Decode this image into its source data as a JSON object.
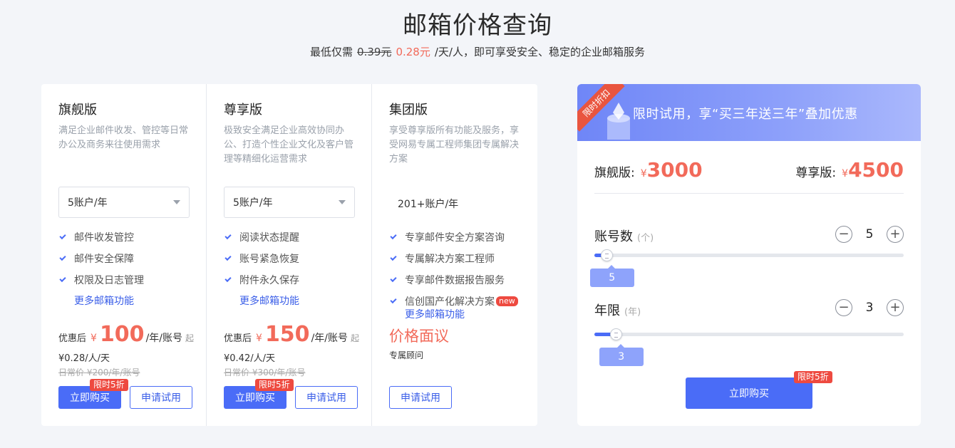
{
  "header": {
    "title": "邮箱价格查询",
    "subtitle_prefix": "最低仅需",
    "old_price": "0.39元",
    "new_price": "0.28元",
    "subtitle_suffix": "/天/人，即可享受安全、稳定的企业邮箱服务"
  },
  "plans": [
    {
      "name": "旗舰版",
      "desc": "满足企业邮件收发、管控等日常办公及商务来往使用需求",
      "account_select": "5账户/年",
      "features": [
        "邮件收发管控",
        "邮件安全保障",
        "权限及日志管理"
      ],
      "more": "更多邮箱功能",
      "price_prefix": "优惠后",
      "currency": "¥",
      "price": "100",
      "price_unit": "/年/账号",
      "price_suffix": "起",
      "daily": "¥0.28/人/天",
      "original": "日常价 ¥200/年/账号",
      "discount_tag": "限时5折",
      "buy": "立即购买",
      "trial": "申请试用"
    },
    {
      "name": "尊享版",
      "desc": "极致安全满足企业高效协同办公、打造个性企业文化及客户管理等精细化运营需求",
      "account_select": "5账户/年",
      "features": [
        "阅读状态提醒",
        "账号紧急恢复",
        "附件永久保存"
      ],
      "more": "更多邮箱功能",
      "price_prefix": "优惠后",
      "currency": "¥",
      "price": "150",
      "price_unit": "/年/账号",
      "price_suffix": "起",
      "daily": "¥0.42/人/天",
      "original": "日常价 ¥300/年/账号",
      "discount_tag": "限时5折",
      "buy": "立即购买",
      "trial": "申请试用"
    },
    {
      "name": "集团版",
      "desc": "享受尊享版所有功能及服务，享受网易专属工程师集团专属解决方案",
      "account_static": "201+账户/年",
      "features": [
        "专享邮件安全方案咨询",
        "专属解决方案工程师",
        "专享邮件数据报告服务",
        "信创国产化解决方案"
      ],
      "new_badge": "new",
      "more": "更多邮箱功能",
      "negotiate": "价格面议",
      "consult": "专属顾问",
      "trial": "申请试用"
    }
  ],
  "promo": {
    "ribbon": "限时折扣",
    "headline": "限时试用，享“买三年送三年”叠加优惠",
    "flagship_label": "旗舰版:",
    "flagship_currency": "¥",
    "flagship_price": "3000",
    "premium_label": "尊享版:",
    "premium_currency": "¥",
    "premium_price": "4500",
    "accounts_label": "账号数",
    "accounts_unit": "(个)",
    "accounts_value": "5",
    "accounts_fill_fraction": 0.02,
    "years_label": "年限",
    "years_unit": "(年)",
    "years_value": "3",
    "years_fill_fraction": 0.05,
    "minus": "−",
    "plus": "+",
    "discount_tag": "限时5折",
    "buy": "立即购买"
  },
  "colors": {
    "accent": "#4a6cf7",
    "price": "#f26a5a",
    "tag": "#ee4a40"
  }
}
